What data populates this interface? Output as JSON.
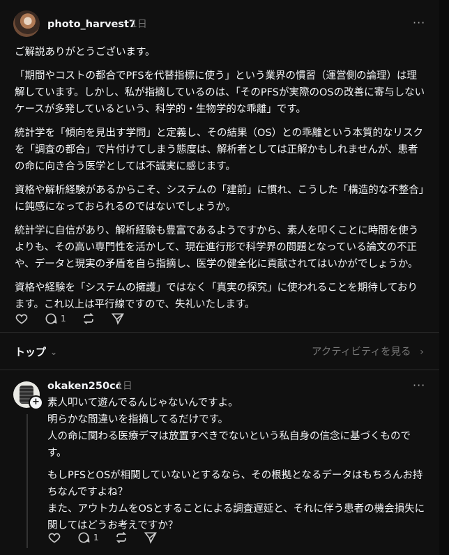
{
  "post": {
    "username": "photo_harvest7",
    "time": "1日",
    "paragraphs": [
      "ご解説ありがとうございます。",
      "「期間やコストの都合でPFSを代替指標に使う」という業界の慣習（運営側の論理）は理解しています。しかし、私が指摘しているのは、「そのPFSが実際のOSの改善に寄与しないケースが多発しているという、科学的・生物学的な乖離」です。",
      "統計学を「傾向を見出す学問」と定義し、その結果（OS）との乖離という本質的なリスクを「調査の都合」で片付けてしまう態度は、解析者としては正解かもしれませんが、患者の命に向き合う医学としては不誠実に感じます。",
      "資格や解析経験があるからこそ、システムの「建前」に慣れ、こうした「構造的な不整合」に鈍感になっておられるのではないでしょうか。",
      "統計学に自信があり、解析経験も豊富であるようですから、素人を叩くことに時間を使うよりも、その高い専門性を活かして、現在進行形で科学界の問題となっている論文の不正や、データと現実の矛盾を自ら指摘し、医学の健全化に貢献されてはいかがでしょうか。",
      "資格や経験を「システムの擁護」ではなく「真実の探究」に使われることを期待しております。これ以上は平行線ですので、失礼いたします。"
    ],
    "reply_count": "1"
  },
  "sort": {
    "label": "トップ",
    "chevron": "⌄"
  },
  "activity": {
    "label": "アクティビティを見る",
    "chevron": "›"
  },
  "reply": {
    "username": "okaken250cc",
    "time": "1日",
    "plus": "+",
    "paragraphs": [
      "素人叩いて遊んでるんじゃないんですよ。\n明らかな間違いを指摘してるだけです。\n人の命に関わる医療デマは放置すべきでないという私自身の信念に基づくものです。",
      "もしPFSとOSが相関していないとするなら、その根拠となるデータはもちろんお持ちなんですよね？\nまた、アウトカムをOSとすることによる調査遅延と、それに伴う患者の機会損失に関してはどうお考えですか？"
    ],
    "reply_count": "1"
  },
  "more_label": "···"
}
